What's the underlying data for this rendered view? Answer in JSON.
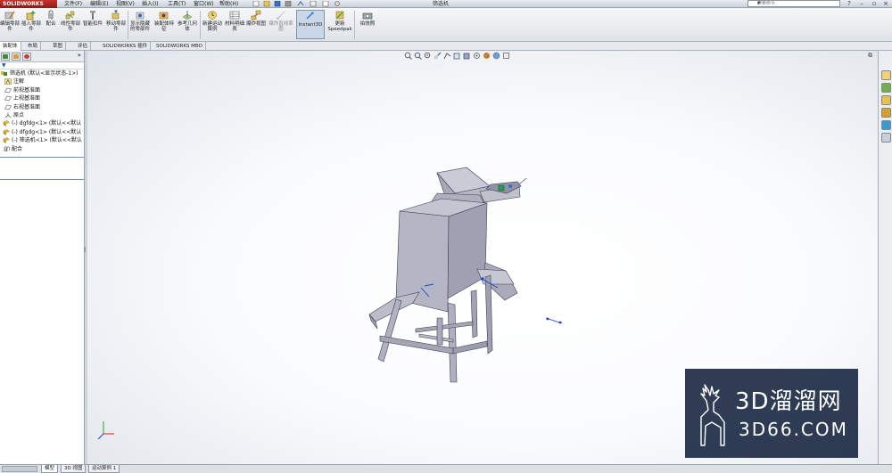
{
  "app": {
    "brand": "SOLIDWORKS",
    "document_title": "筛选机"
  },
  "menu": [
    "文件(F)",
    "编辑(E)",
    "视图(V)",
    "插入(I)",
    "工具(T)",
    "窗口(W)",
    "帮助(H)"
  ],
  "search": {
    "placeholder": "搜索命令"
  },
  "ribbon": {
    "buttons": [
      {
        "label": "编辑零部件"
      },
      {
        "label": "插入零部件"
      },
      {
        "label": "配合"
      },
      {
        "label": "线性零部件"
      },
      {
        "label": "智能扣件"
      },
      {
        "label": "移动零部件"
      },
      {
        "label": "显示隐藏的零部件"
      },
      {
        "label": "装配体特征"
      },
      {
        "label": "参考几何体"
      },
      {
        "label": "新建运动算例"
      },
      {
        "label": "材料明细表"
      },
      {
        "label": "爆炸视图"
      },
      {
        "label": "爆炸直线草图"
      },
      {
        "label": "Instant3D"
      },
      {
        "label": "更新Speedpak"
      },
      {
        "label": "拍快照"
      }
    ]
  },
  "command_tabs": [
    "装配体",
    "布局",
    "草图",
    "评估",
    "SOLIDWORKS 插件",
    "SOLIDWORKS MBD"
  ],
  "feature_tree": {
    "filter_symbol": "▼",
    "nodes": [
      {
        "label": "筛选机 (默认<显示状态-1>)"
      },
      {
        "label": "注解"
      },
      {
        "label": "前视基准面"
      },
      {
        "label": "上视基准面"
      },
      {
        "label": "右视基准面"
      },
      {
        "label": "原点"
      },
      {
        "label": "(-) dgfdg<1> (默认<<默认"
      },
      {
        "label": "(-) dfgdg<1> (默认<<默认"
      },
      {
        "label": "(-) 筛选机<1> (默认<<默认"
      },
      {
        "label": "配合"
      }
    ]
  },
  "bottom_tabs": [
    "模型",
    "3D 视图",
    "运动算例 1"
  ],
  "watermark": {
    "title": "3D溜溜网",
    "subtitle": "3D66.COM"
  },
  "colors": {
    "accent": "#2a58c0",
    "watermark_bg": "#12213c",
    "model_fill": "#b4b6c4"
  }
}
